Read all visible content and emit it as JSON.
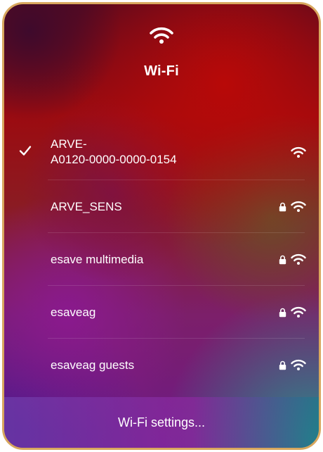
{
  "header": {
    "icon": "wifi-icon",
    "title": "Wi-Fi"
  },
  "networks": [
    {
      "name": "ARVE-A0120-0000-0000-0154",
      "name_line1": "ARVE-",
      "name_line2": "A0120-0000-0000-0154",
      "connected": true,
      "secured": false
    },
    {
      "name": "ARVE_SENS",
      "connected": false,
      "secured": true
    },
    {
      "name": "esave multimedia",
      "connected": false,
      "secured": true
    },
    {
      "name": "esaveag",
      "connected": false,
      "secured": true
    },
    {
      "name": "esaveag guests",
      "connected": false,
      "secured": true
    }
  ],
  "footer": {
    "settings_label": "Wi-Fi settings..."
  },
  "colors": {
    "frame_border": "#d8a75e",
    "text": "#ffffff"
  }
}
